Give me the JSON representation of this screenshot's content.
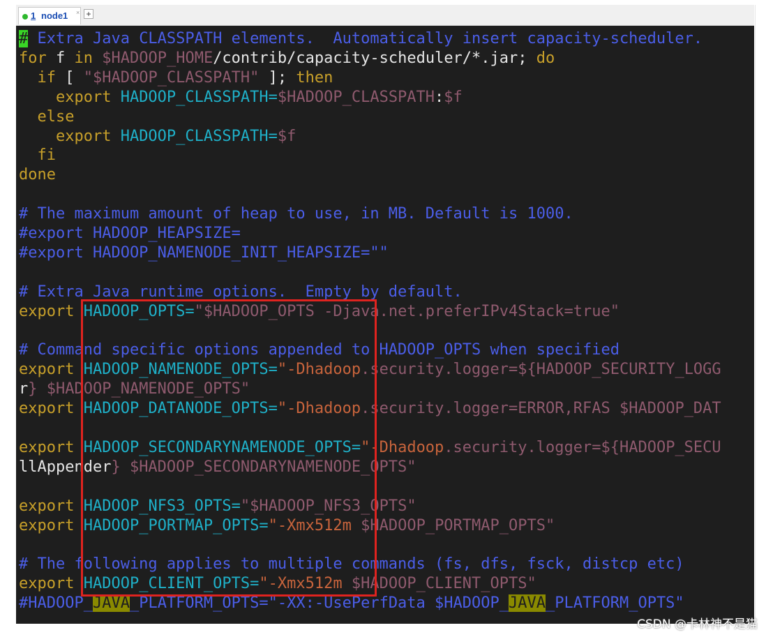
{
  "tab": {
    "number": "1",
    "name": "node1",
    "close": "×",
    "add": "+"
  },
  "colors": {
    "background": "#1e1e1e",
    "comment": "#4b5ee8",
    "keyword": "#c8a02a",
    "variable": "#8f5a6e",
    "plain": "#e6e6e6",
    "identifier": "#1fb0c8",
    "string": "#c8643c",
    "cursor": "#39d626",
    "highlight": "#8a8a00",
    "annotation": "#e0231f"
  },
  "code_lines": [
    [
      [
        "cursor",
        "#"
      ],
      [
        "comment",
        " Extra Java CLASSPATH elements.  Automatically insert capacity-scheduler."
      ]
    ],
    [
      [
        "keyword",
        "for"
      ],
      [
        "plain",
        " f "
      ],
      [
        "keyword",
        "in"
      ],
      [
        "variable",
        " $HADOOP_HOME"
      ],
      [
        "plain",
        "/contrib/capacity-scheduler/*.jar; "
      ],
      [
        "keyword",
        "do"
      ]
    ],
    [
      [
        "keyword",
        "  if"
      ],
      [
        "plain",
        " [ "
      ],
      [
        "variable",
        "\"$HADOOP_CLASSPATH\""
      ],
      [
        "plain",
        " ]; "
      ],
      [
        "keyword",
        "then"
      ]
    ],
    [
      [
        "keyword",
        "    export"
      ],
      [
        "identifier",
        " HADOOP_CLASSPATH="
      ],
      [
        "variable",
        "$HADOOP_CLASSPATH"
      ],
      [
        "plain",
        ":"
      ],
      [
        "variable",
        "$f"
      ]
    ],
    [
      [
        "keyword",
        "  else"
      ]
    ],
    [
      [
        "keyword",
        "    export"
      ],
      [
        "identifier",
        " HADOOP_CLASSPATH="
      ],
      [
        "variable",
        "$f"
      ]
    ],
    [
      [
        "keyword",
        "  fi"
      ]
    ],
    [
      [
        "keyword",
        "done"
      ]
    ],
    [],
    [
      [
        "comment",
        "# The maximum amount of heap to use, in MB. Default is 1000."
      ]
    ],
    [
      [
        "comment",
        "#export HADOOP_HEAPSIZE="
      ]
    ],
    [
      [
        "comment",
        "#export HADOOP_NAMENODE_INIT_HEAPSIZE=\"\""
      ]
    ],
    [],
    [
      [
        "comment",
        "# Extra Java runtime options.  Empty by default."
      ]
    ],
    [
      [
        "keyword",
        "export"
      ],
      [
        "identifier",
        " HADOOP_OPTS="
      ],
      [
        "variable",
        "\"$HADOOP_OPTS -Djava.net.preferIPv4Stack=true\""
      ]
    ],
    [],
    [
      [
        "comment",
        "# Command specific options appended to HADOOP_OPTS when specified"
      ]
    ],
    [
      [
        "keyword",
        "export"
      ],
      [
        "identifier",
        " HADOOP_NAMENODE_OPTS="
      ],
      [
        "string",
        "\"-Dhadoop"
      ],
      [
        "variable",
        ".security.logger=${HADOOP_SECURITY_LOGG"
      ]
    ],
    [
      [
        "plain",
        "r"
      ],
      [
        "variable",
        "} $HADOOP_NAMENODE_OPTS\""
      ]
    ],
    [
      [
        "keyword",
        "export"
      ],
      [
        "identifier",
        " HADOOP_DATANODE_OPTS="
      ],
      [
        "string",
        "\"-Dhadoop"
      ],
      [
        "variable",
        ".security.logger=ERROR,RFAS $HADOOP_DAT"
      ]
    ],
    [],
    [
      [
        "keyword",
        "export"
      ],
      [
        "identifier",
        " HADOOP_SECONDARYNAMENODE_OPTS="
      ],
      [
        "string",
        "\"-Dhadoop"
      ],
      [
        "variable",
        ".security.logger=${HADOOP_SECU"
      ]
    ],
    [
      [
        "plain",
        "llAppender"
      ],
      [
        "variable",
        "} $HADOOP_SECONDARYNAMENODE_OPTS\""
      ]
    ],
    [],
    [
      [
        "keyword",
        "export"
      ],
      [
        "identifier",
        " HADOOP_NFS3_OPTS="
      ],
      [
        "variable",
        "\"$HADOOP_NFS3_OPTS\""
      ]
    ],
    [
      [
        "keyword",
        "export"
      ],
      [
        "identifier",
        " HADOOP_PORTMAP_OPTS="
      ],
      [
        "string",
        "\"-Xmx512m"
      ],
      [
        "variable",
        " $HADOOP_PORTMAP_OPTS\""
      ]
    ],
    [],
    [
      [
        "comment",
        "# The following applies to multiple commands (fs, dfs, fsck, distcp etc)"
      ]
    ],
    [
      [
        "keyword",
        "export"
      ],
      [
        "identifier",
        " HADOOP_CLIENT_OPTS="
      ],
      [
        "string",
        "\"-Xmx512m"
      ],
      [
        "variable",
        " $HADOOP_CLIENT_OPTS\""
      ]
    ],
    [
      [
        "comment",
        "#HADOOP_"
      ],
      [
        "hl",
        "JAVA"
      ],
      [
        "comment",
        "_PLATFORM_OPTS=\"-XX:-UsePerfData $HADOOP_"
      ],
      [
        "hl",
        "JAVA"
      ],
      [
        "comment",
        "_PLATFORM_OPTS\""
      ]
    ]
  ],
  "watermark": "CSDN @卡林神不是猫"
}
